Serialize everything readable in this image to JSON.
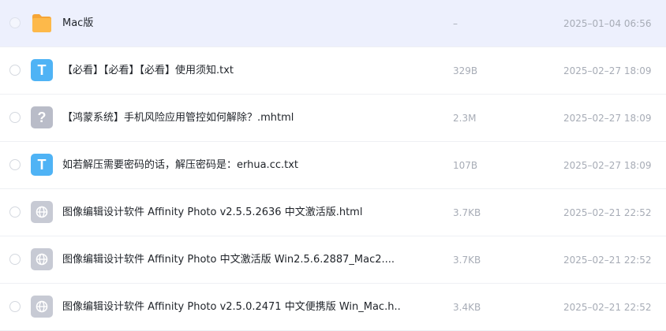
{
  "files": [
    {
      "name": "Mac版",
      "size": "–",
      "date": "2025–01–04 06:56",
      "icon": "folder-icon",
      "selected": true
    },
    {
      "name": "【必看】【必看】【必看】使用须知.txt",
      "size": "329B",
      "date": "2025–02–27 18:09",
      "icon": "txt-file-icon",
      "badge": "T"
    },
    {
      "name": "【鸿蒙系统】手机风险应用管控如何解除？.mhtml",
      "size": "2.3M",
      "date": "2025–02–27 18:09",
      "icon": "unknown-file-icon",
      "badge": "?"
    },
    {
      "name": "如若解压需要密码的话，解压密码是：erhua.cc.txt",
      "size": "107B",
      "date": "2025–02–27 18:09",
      "icon": "txt-file-icon",
      "badge": "T"
    },
    {
      "name": "图像编辑设计软件 Affinity Photo v2.5.5.2636 中文激活版.html",
      "size": "3.7KB",
      "date": "2025–02–21 22:52",
      "icon": "html-file-icon"
    },
    {
      "name": "图像编辑设计软件 Affinity Photo 中文激活版 Win2.5.6.2887_Mac2....",
      "size": "3.7KB",
      "date": "2025–02–21 22:52",
      "icon": "html-file-icon"
    },
    {
      "name": "图像编辑设计软件 Affinity Photo v2.5.0.2471 中文便携版 Win_Mac.h...",
      "size": "3.4KB",
      "date": "2025–02–21 22:52",
      "icon": "html-file-icon"
    }
  ],
  "colors": {
    "selected_row": "#edf0fd",
    "folder": "#fbb040",
    "txt_badge": "#4fb3f5",
    "unknown_badge": "#b9bcc8",
    "html_badge": "#c7cad4"
  }
}
